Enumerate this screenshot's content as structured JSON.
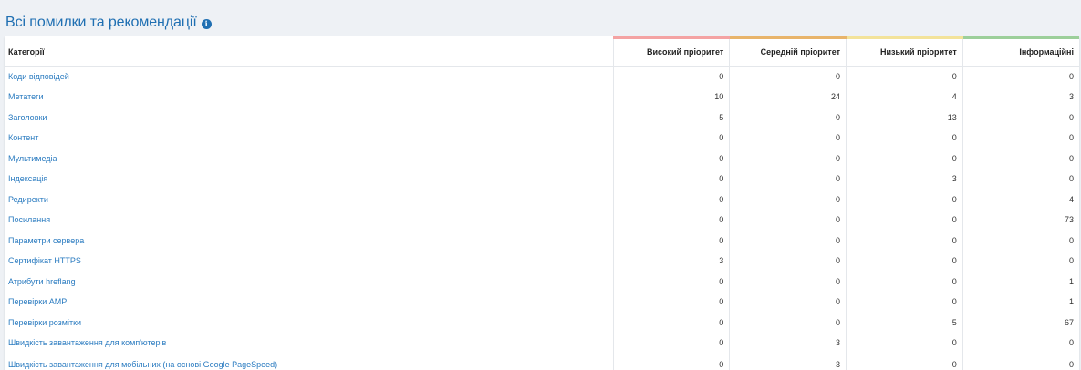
{
  "header": {
    "title": "Всі помилки та рекомендації",
    "info_icon": "i"
  },
  "table": {
    "columns": [
      {
        "label": "Категорії"
      },
      {
        "label": "Високий пріоритет",
        "color": "#f4a3a3"
      },
      {
        "label": "Середній пріоритет",
        "color": "#e8b46a"
      },
      {
        "label": "Низький пріоритет",
        "color": "#f3e39a"
      },
      {
        "label": "Інформаційні",
        "color": "#9ccf9a"
      }
    ],
    "rows": [
      {
        "category": "Коди відповідей",
        "high": "0",
        "medium": "0",
        "low": "0",
        "info": "0"
      },
      {
        "category": "Метатеги",
        "high": "10",
        "medium": "24",
        "low": "4",
        "info": "3"
      },
      {
        "category": "Заголовки",
        "high": "5",
        "medium": "0",
        "low": "13",
        "info": "0"
      },
      {
        "category": "Контент",
        "high": "0",
        "medium": "0",
        "low": "0",
        "info": "0"
      },
      {
        "category": "Мультимедіа",
        "high": "0",
        "medium": "0",
        "low": "0",
        "info": "0"
      },
      {
        "category": "Індексація",
        "high": "0",
        "medium": "0",
        "low": "3",
        "info": "0"
      },
      {
        "category": "Редиректи",
        "high": "0",
        "medium": "0",
        "low": "0",
        "info": "4"
      },
      {
        "category": "Посилання",
        "high": "0",
        "medium": "0",
        "low": "0",
        "info": "73"
      },
      {
        "category": "Параметри сервера",
        "high": "0",
        "medium": "0",
        "low": "0",
        "info": "0"
      },
      {
        "category": "Сертифікат HTTPS",
        "high": "3",
        "medium": "0",
        "low": "0",
        "info": "0"
      },
      {
        "category": "Атрибути hreflang",
        "high": "0",
        "medium": "0",
        "low": "0",
        "info": "1"
      },
      {
        "category": "Перевірки AMP",
        "high": "0",
        "medium": "0",
        "low": "0",
        "info": "1"
      },
      {
        "category": "Перевірки розмітки",
        "high": "0",
        "medium": "0",
        "low": "5",
        "info": "67"
      },
      {
        "category": "Швидкість завантаження для комп'ютерів",
        "high": "0",
        "medium": "3",
        "low": "0",
        "info": "0"
      },
      {
        "category": "Швидкість завантаження для мобільних (на основі Google PageSpeed)",
        "high": "0",
        "medium": "3",
        "low": "0",
        "info": "0"
      }
    ]
  }
}
